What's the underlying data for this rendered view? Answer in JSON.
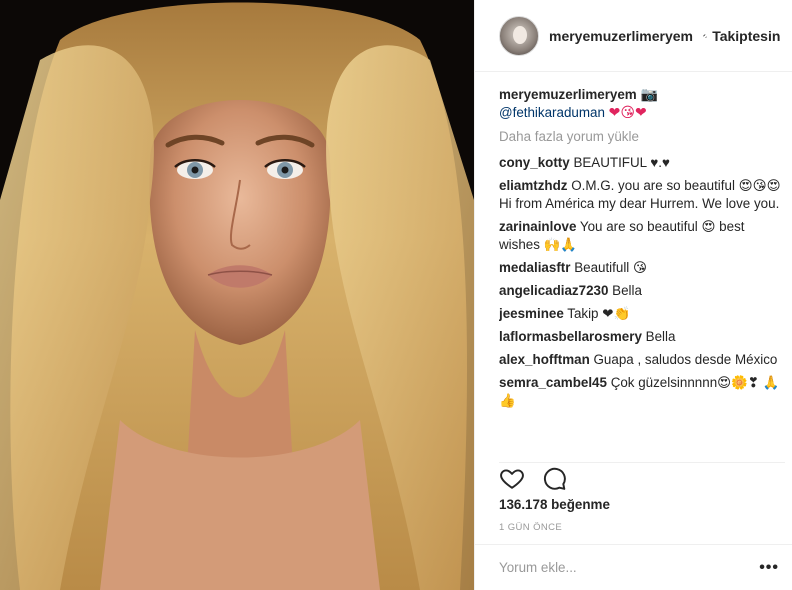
{
  "post": {
    "author": "meryemuzerlimeryem",
    "follow_separator": "•",
    "follow_label": "Takiptesin",
    "caption": {
      "user": "meryemuzerlimeryem",
      "camera_emoji": "📷",
      "mention": "@fethikaraduman",
      "emojis": "❤😘❤"
    },
    "load_more": "Daha fazla yorum yükle",
    "comments": [
      {
        "user": "cony_kotty",
        "text": "BEAUTIFUL ♥.♥"
      },
      {
        "user": "eliamtzhdz",
        "text": "O.M.G. you are so beautiful 😍😘😍 Hi from América my dear Hurrem. We love you."
      },
      {
        "user": "zarinainlove",
        "text": "You are so beautiful 😍 best wishes 🙌🙏"
      },
      {
        "user": "medaliasftr",
        "text": "Beautifull 😘"
      },
      {
        "user": "angelicadiaz7230",
        "text": "Bella"
      },
      {
        "user": "jeesminee",
        "text": "Takip ❤👏"
      },
      {
        "user": "laflormasbellarosmery",
        "text": "Bella"
      },
      {
        "user": "alex_hofftman",
        "text": "Guapa , saludos desde México"
      },
      {
        "user": "semra_cambel45",
        "text": "Çok güzelsinnnnn😍🌼❣ 🙏👍"
      }
    ],
    "likes": "136.178 beğenme",
    "time_ago": "1 GÜN ÖNCE",
    "add_comment_placeholder": "Yorum ekle...",
    "more_options": "•••"
  },
  "icons": {
    "like": "heart-outline-icon",
    "comment": "speech-bubble-icon",
    "verified": "verified-badge-icon",
    "more": "ellipsis-icon"
  },
  "colors": {
    "verified": "#3897f0",
    "mention": "#003569",
    "muted": "#999999",
    "text": "#262626",
    "border": "#efefef"
  }
}
